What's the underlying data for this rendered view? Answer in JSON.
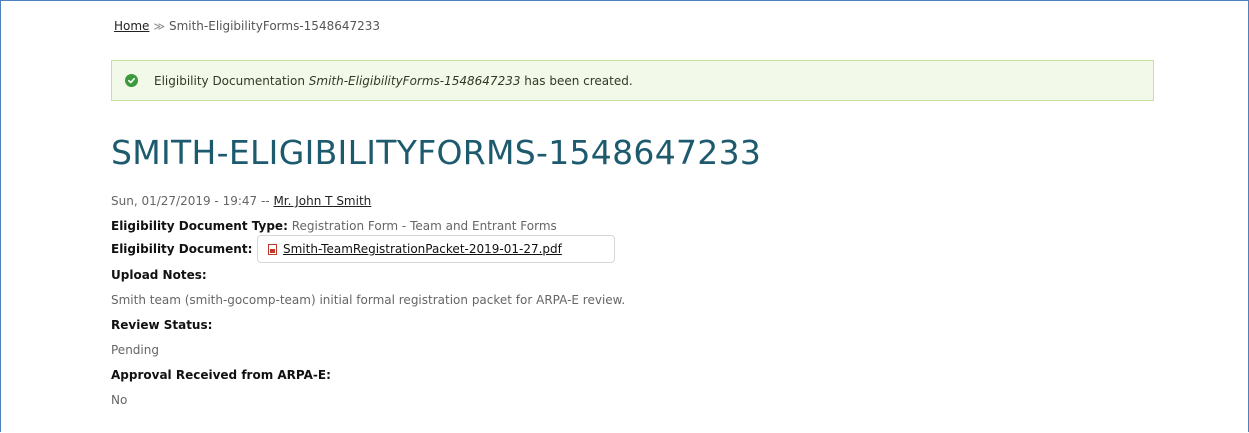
{
  "breadcrumb": {
    "home_label": "Home",
    "separator": "≫",
    "current": "Smith-EligibilityForms-1548647233"
  },
  "alert": {
    "prefix": "Eligibility Documentation ",
    "title": "Smith-EligibilityForms-1548647233",
    "suffix": " has been created.",
    "icon": "check-circle-icon",
    "color": "#3c9a3c"
  },
  "page": {
    "title": "SMITH-ELIGIBILITYFORMS-1548647233",
    "title_color": "#1d5a6e"
  },
  "meta": {
    "date": "Sun, 01/27/2019 - 19:47 -- ",
    "author": "Mr. John T Smith"
  },
  "fields": {
    "doc_type_label": "Eligibility Document Type:",
    "doc_type_value": "Registration Form - Team and Entrant Forms",
    "doc_label": "Eligibility Document:",
    "doc_file": "Smith-TeamRegistrationPacket-2019-01-27.pdf",
    "doc_icon": "pdf-file-icon",
    "notes_label": "Upload Notes:",
    "notes_value": "Smith team (smith-gocomp-team) initial formal registration packet for ARPA-E review.",
    "review_label": "Review Status:",
    "review_value": "Pending",
    "approval_label": "Approval Received from ARPA-E:",
    "approval_value": "No"
  }
}
